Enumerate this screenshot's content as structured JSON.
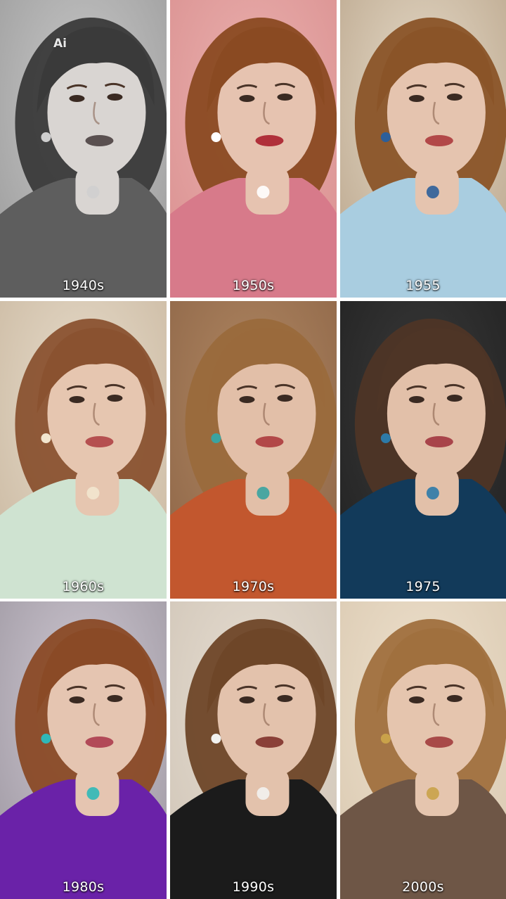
{
  "watermark": "Ai",
  "panels": [
    {
      "label": "1940s",
      "style": "grayscale",
      "bg": "#9a9a9a",
      "bg2": "#c8c8c8",
      "hair": "#3a3a3a",
      "skin": "#d9d5d2",
      "lip": "#5a5050",
      "outfit": "#5e5e5e",
      "detail": "#cfcfcf"
    },
    {
      "label": "1950s",
      "style": "color",
      "bg": "#d98f8f",
      "bg2": "#eab0ae",
      "hair": "#8a4a22",
      "skin": "#e6c3b0",
      "lip": "#b0303a",
      "outfit": "#d77a8a",
      "detail": "#ffffff"
    },
    {
      "label": "1955",
      "style": "color",
      "bg": "#b9a48a",
      "bg2": "#e6dbc9",
      "hair": "#8a5428",
      "skin": "#e5c4af",
      "lip": "#b24848",
      "outfit": "#a9cde0",
      "detail": "#2c5f9a"
    },
    {
      "label": "1960s",
      "style": "color",
      "bg": "#c9b79f",
      "bg2": "#e7dccb",
      "hair": "#8a5230",
      "skin": "#e6c6b0",
      "lip": "#b55050",
      "outfit": "#cfe3d1",
      "detail": "#f2e6cf"
    },
    {
      "label": "1970s",
      "style": "color",
      "bg": "#8c6446",
      "bg2": "#b08762",
      "hair": "#9a6a3c",
      "skin": "#e2bfa8",
      "lip": "#b24848",
      "outfit": "#c2572e",
      "detail": "#3aa3a0"
    },
    {
      "label": "1975",
      "style": "color",
      "bg": "#202020",
      "bg2": "#3a3a3a",
      "hair": "#4e3526",
      "skin": "#e2c0a9",
      "lip": "#a8444a",
      "outfit": "#123a5a",
      "detail": "#2d7aa8"
    },
    {
      "label": "1980s",
      "style": "color",
      "bg": "#9c96a0",
      "bg2": "#cfc8d2",
      "hair": "#8a4a26",
      "skin": "#e5c5b1",
      "lip": "#b24a58",
      "outfit": "#6a22a8",
      "detail": "#2fb8b8"
    },
    {
      "label": "1990s",
      "style": "color",
      "bg": "#cfc4b6",
      "bg2": "#e6ddd1",
      "hair": "#6e4628",
      "skin": "#e3c2ac",
      "lip": "#8a4038",
      "outfit": "#1b1b1b",
      "detail": "#f2f2f0"
    },
    {
      "label": "2000s",
      "style": "color",
      "bg": "#d9c8b0",
      "bg2": "#eee1cd",
      "hair": "#a0703e",
      "skin": "#e5c5ae",
      "lip": "#a84a48",
      "outfit": "#6e5646",
      "detail": "#c9a24a"
    }
  ]
}
